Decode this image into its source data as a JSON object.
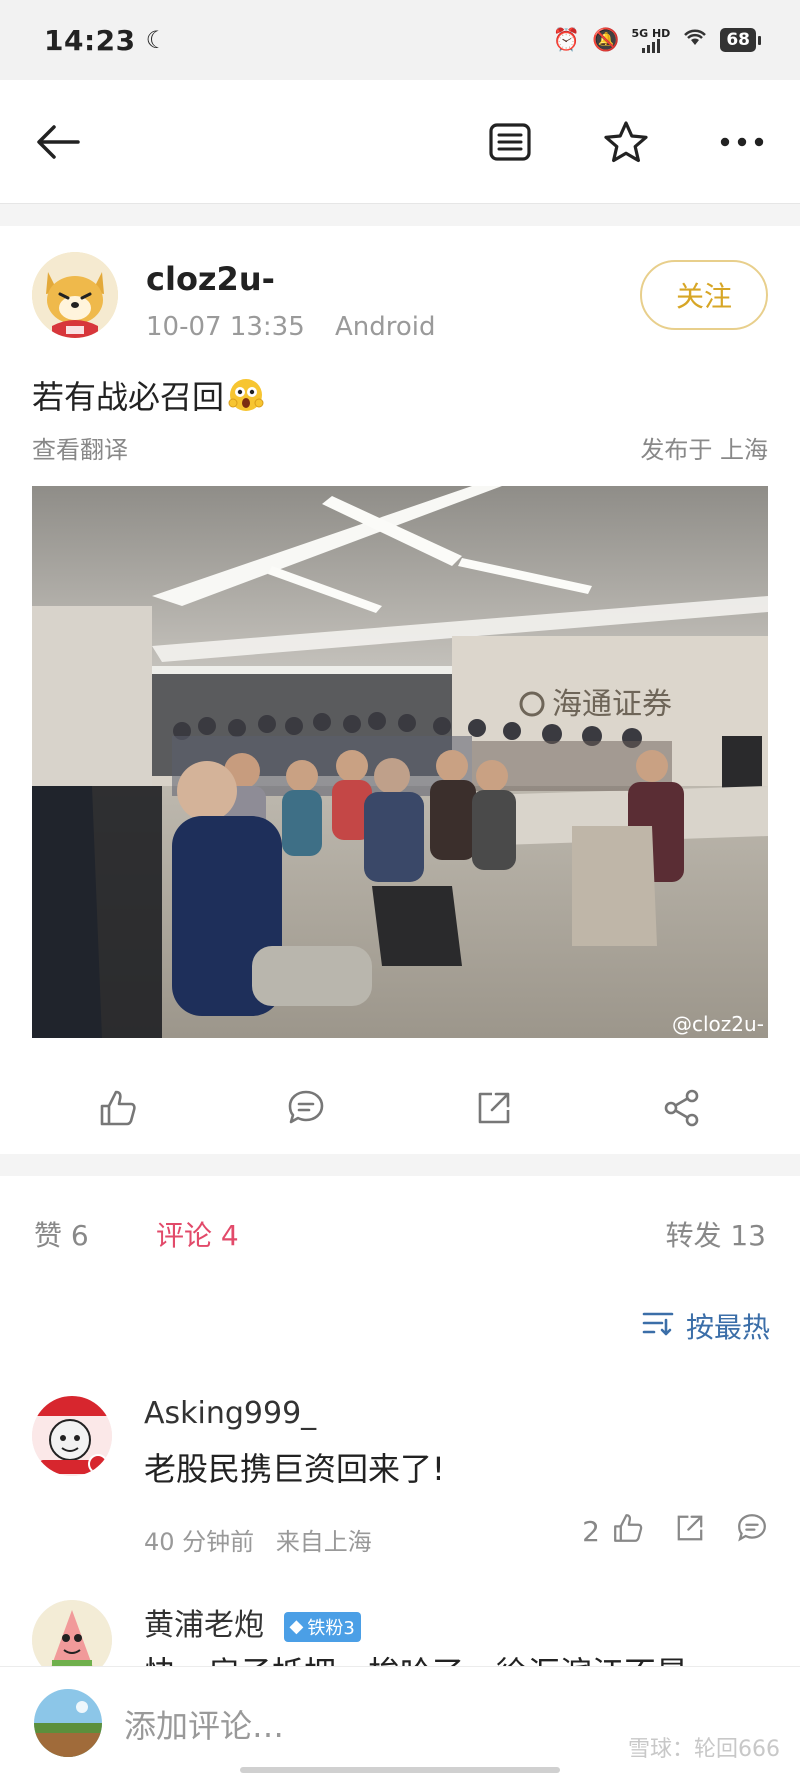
{
  "status_bar": {
    "time": "14:23",
    "network": "5G HD",
    "battery": "68"
  },
  "nav": {
    "back": "back-arrow-icon",
    "reader": "reader-mode-icon",
    "favorite": "star-icon",
    "more": "more-icon"
  },
  "post": {
    "author": "cloz2u-",
    "date": "10-07 13:35",
    "device": "Android",
    "follow_label": "关注",
    "text": "若有战必召回",
    "translate_label": "查看翻译",
    "location": "发布于 上海",
    "photo_watermark": "@cloz2u-",
    "photo_sign": "海通证券"
  },
  "tabs": {
    "likes": "赞 6",
    "comments": "评论 4",
    "reposts": "转发 13"
  },
  "sort": {
    "label": "按最热",
    "icon": "sort-icon"
  },
  "comments": [
    {
      "name": "Asking999_",
      "text": "老股民携巨资回来了!",
      "time": "40 分钟前",
      "from": "来自上海",
      "likes": "2"
    },
    {
      "name": "黄浦老炮",
      "badge": "铁粉3",
      "text": "快，房子抵押，梭哈了，徐汇滨江不是"
    }
  ],
  "bottom": {
    "placeholder": "添加评论…",
    "watermark": "雪球：轮回666"
  },
  "colors": {
    "accent_pink": "#e24a6a",
    "follow_gold": "#d7a626",
    "sort_blue": "#3b6ea8"
  }
}
